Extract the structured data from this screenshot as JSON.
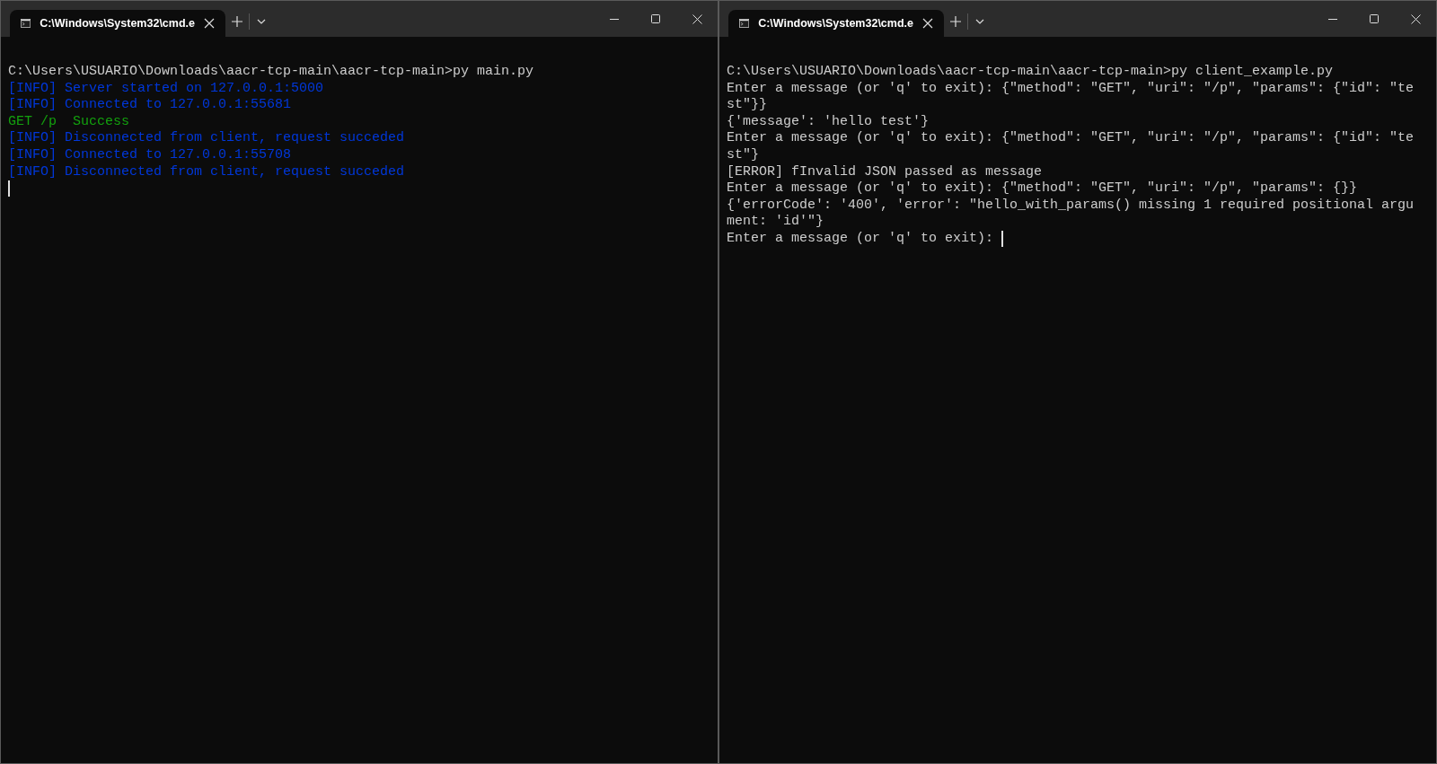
{
  "windows": [
    {
      "tab": {
        "title": "C:\\Windows\\System32\\cmd.e",
        "selected": true
      },
      "lines": [
        {
          "kind": "plain",
          "text": "C:\\Users\\USUARIO\\Downloads\\aacr-tcp-main\\aacr-tcp-main>py main.py",
          "cursor": false
        },
        {
          "kind": "info",
          "text": "[INFO] Server started on 127.0.0.1:5000",
          "cursor": false
        },
        {
          "kind": "info",
          "text": "[INFO] Connected to 127.0.0.1:55681",
          "cursor": false
        },
        {
          "kind": "success",
          "text": "GET /p  Success",
          "cursor": false
        },
        {
          "kind": "info",
          "text": "[INFO] Disconnected from client, request succeded",
          "cursor": false
        },
        {
          "kind": "info",
          "text": "[INFO] Connected to 127.0.0.1:55708",
          "cursor": false
        },
        {
          "kind": "info",
          "text": "[INFO] Disconnected from client, request succeded",
          "cursor": false
        },
        {
          "cursor": true
        }
      ]
    },
    {
      "tab": {
        "title": "C:\\Windows\\System32\\cmd.e",
        "selected": true
      },
      "lines": [
        {
          "kind": "plain",
          "text": "C:\\Users\\USUARIO\\Downloads\\aacr-tcp-main\\aacr-tcp-main>py client_example.py",
          "cursor": false
        },
        {
          "kind": "plain",
          "text": "Enter a message (or 'q' to exit): {\"method\": \"GET\", \"uri\": \"/p\", \"params\": {\"id\": \"te",
          "cursor": false
        },
        {
          "kind": "plain",
          "text": "st\"}}",
          "cursor": false
        },
        {
          "kind": "plain",
          "text": "{'message': 'hello test'}",
          "cursor": false
        },
        {
          "kind": "plain",
          "text": "Enter a message (or 'q' to exit): {\"method\": \"GET\", \"uri\": \"/p\", \"params\": {\"id\": \"te",
          "cursor": false
        },
        {
          "kind": "plain",
          "text": "st\"}",
          "cursor": false
        },
        {
          "kind": "plain",
          "text": "[ERROR] fInvalid JSON passed as message",
          "cursor": false
        },
        {
          "kind": "plain",
          "text": "Enter a message (or 'q' to exit): {\"method\": \"GET\", \"uri\": \"/p\", \"params\": {}}",
          "cursor": false
        },
        {
          "kind": "plain",
          "text": "{'errorCode': '400', 'error': \"hello_with_params() missing 1 required positional argu",
          "cursor": false
        },
        {
          "kind": "plain",
          "text": "ment: 'id'\"}",
          "cursor": false
        },
        {
          "kind": "plain",
          "text": "Enter a message (or 'q' to exit): ",
          "cursor": true
        }
      ]
    }
  ]
}
